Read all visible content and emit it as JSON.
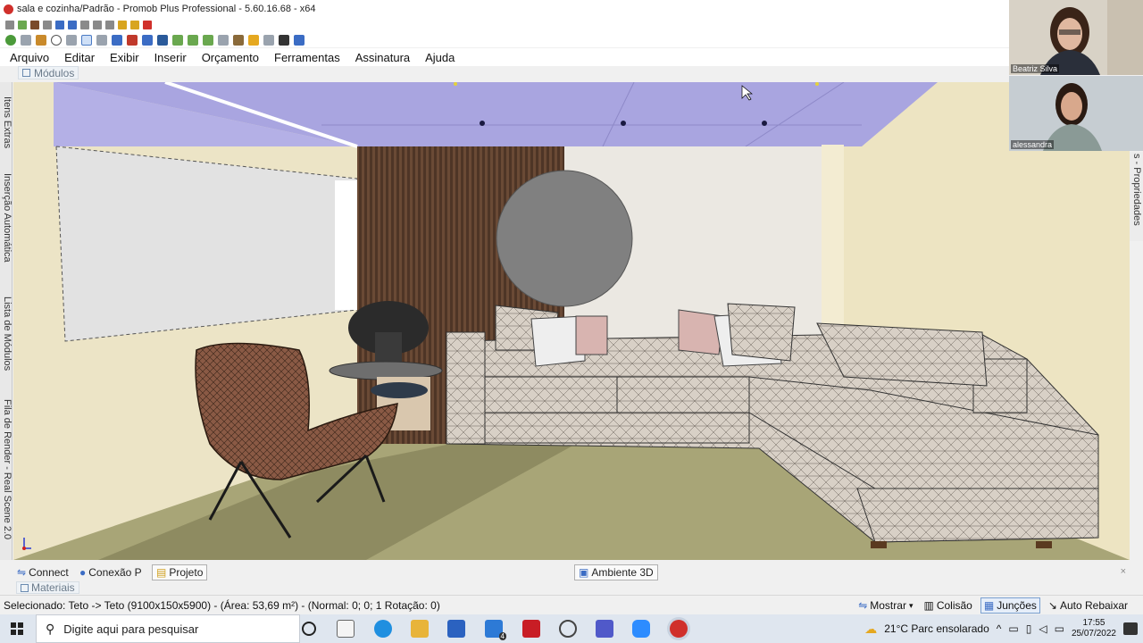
{
  "window": {
    "title": "sala e cozinha/Padrão - Promob Plus Professional - 5.60.16.68 - x64"
  },
  "menu": {
    "items": [
      "Arquivo",
      "Editar",
      "Exibir",
      "Inserir",
      "Orçamento",
      "Ferramentas",
      "Assinatura",
      "Ajuda"
    ]
  },
  "panels": {
    "modules_tab": "Módulos",
    "left_labels": [
      "Itens Extras",
      "Inserção Automática",
      "Lista de Módulos",
      "Fila de Render - Real Scene 2.0"
    ],
    "right_label": "s - Propriedades",
    "materials_tab": "Materiais"
  },
  "view_tabs": {
    "connect": "Connect",
    "conexao": "Conexão P",
    "projeto": "Projeto",
    "ambiente": "Ambiente 3D"
  },
  "status": {
    "selection": "Selecionado: Teto -> Teto (9100x150x5900) - (Área: 53,69 m²) - (Normal: 0; 0; 1 Rotação: 0)",
    "mostrar": "Mostrar",
    "colisao": "Colisão",
    "juncoes": "Junções",
    "auto_rebaixar": "Auto Rebaixar"
  },
  "taskbar": {
    "search_placeholder": "Digite aqui para pesquisar",
    "weather": "21°C  Parc ensolarado",
    "time": "17:55",
    "date": "25/07/2022",
    "mail_badge": "4"
  },
  "participants": [
    {
      "name": "Beatriz Silva"
    },
    {
      "name": "alessandra"
    }
  ],
  "colors": {
    "ceiling": "#a9a5e0",
    "floor": "#a8a577",
    "sofa": "#d9d1c7",
    "slat_wall": "#5a3e2b",
    "accent_red": "#d0302b"
  }
}
